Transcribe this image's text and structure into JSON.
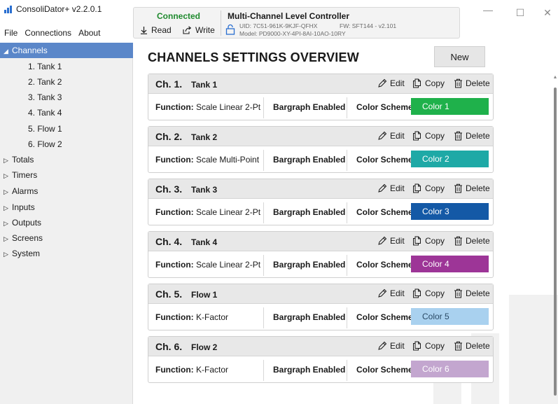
{
  "app": {
    "title": "ConsoliDator+ v2.2.0.1",
    "menu": [
      "File",
      "Connections",
      "About"
    ]
  },
  "connection": {
    "status": "Connected",
    "status_color": "#1f8a2e",
    "read_label": "Read",
    "write_label": "Write",
    "device_name": "Multi-Channel Level Controller",
    "uid": "UID: 7C51-961K-9KJF-QFHX",
    "model": "Model: PD9000-XY-4PI-8AI-10AO-10RY",
    "fw": "FW: SFT144 - v2.101"
  },
  "window_controls": {
    "minimize": "—",
    "maximize": "☐",
    "close": "✕"
  },
  "sidebar": {
    "sections": [
      {
        "label": "Channels",
        "expanded": true,
        "active": true,
        "children": [
          "1. Tank 1",
          "2. Tank 2",
          "3. Tank  3",
          "4. Tank 4",
          "5. Flow 1",
          "6. Flow 2"
        ]
      },
      {
        "label": "Totals",
        "expanded": false
      },
      {
        "label": "Timers",
        "expanded": false
      },
      {
        "label": "Alarms",
        "expanded": false
      },
      {
        "label": "Inputs",
        "expanded": false
      },
      {
        "label": "Outputs",
        "expanded": false
      },
      {
        "label": "Screens",
        "expanded": false
      },
      {
        "label": "System",
        "expanded": false
      }
    ],
    "active_color": "#5b87c9"
  },
  "main": {
    "title": "CHANNELS SETTINGS OVERVIEW",
    "new_button": "New",
    "actions": {
      "edit": "Edit",
      "copy": "Copy",
      "delete": "Delete"
    },
    "function_label": "Function:",
    "color_scheme_label": "Color Scheme:",
    "channels": [
      {
        "num": "Ch. 1.",
        "name": "Tank 1",
        "function": "Scale Linear 2-Pt",
        "bargraph": "Bargraph Enabled",
        "color_name": "Color 1",
        "color": "#1fb14b"
      },
      {
        "num": "Ch. 2.",
        "name": "Tank 2",
        "function": "Scale Multi-Point",
        "bargraph": "Bargraph Enabled",
        "color_name": "Color 2",
        "color": "#1ea9a6"
      },
      {
        "num": "Ch. 3.",
        "name": "Tank  3",
        "function": "Scale Linear 2-Pt",
        "bargraph": "Bargraph Enabled",
        "color_name": "Color 3",
        "color": "#1459a6"
      },
      {
        "num": "Ch. 4.",
        "name": "Tank 4",
        "function": "Scale Linear 2-Pt",
        "bargraph": "Bargraph Enabled",
        "color_name": "Color 4",
        "color": "#9d3597"
      },
      {
        "num": "Ch. 5.",
        "name": "Flow 1",
        "function": "K-Factor",
        "bargraph": "Bargraph Enabled",
        "color_name": "Color 5",
        "color": "#a9d1ef"
      },
      {
        "num": "Ch. 6.",
        "name": "Flow 2",
        "function": "K-Factor",
        "bargraph": "Bargraph Enabled",
        "color_name": "Color 6",
        "color": "#c3a6cf"
      }
    ]
  }
}
